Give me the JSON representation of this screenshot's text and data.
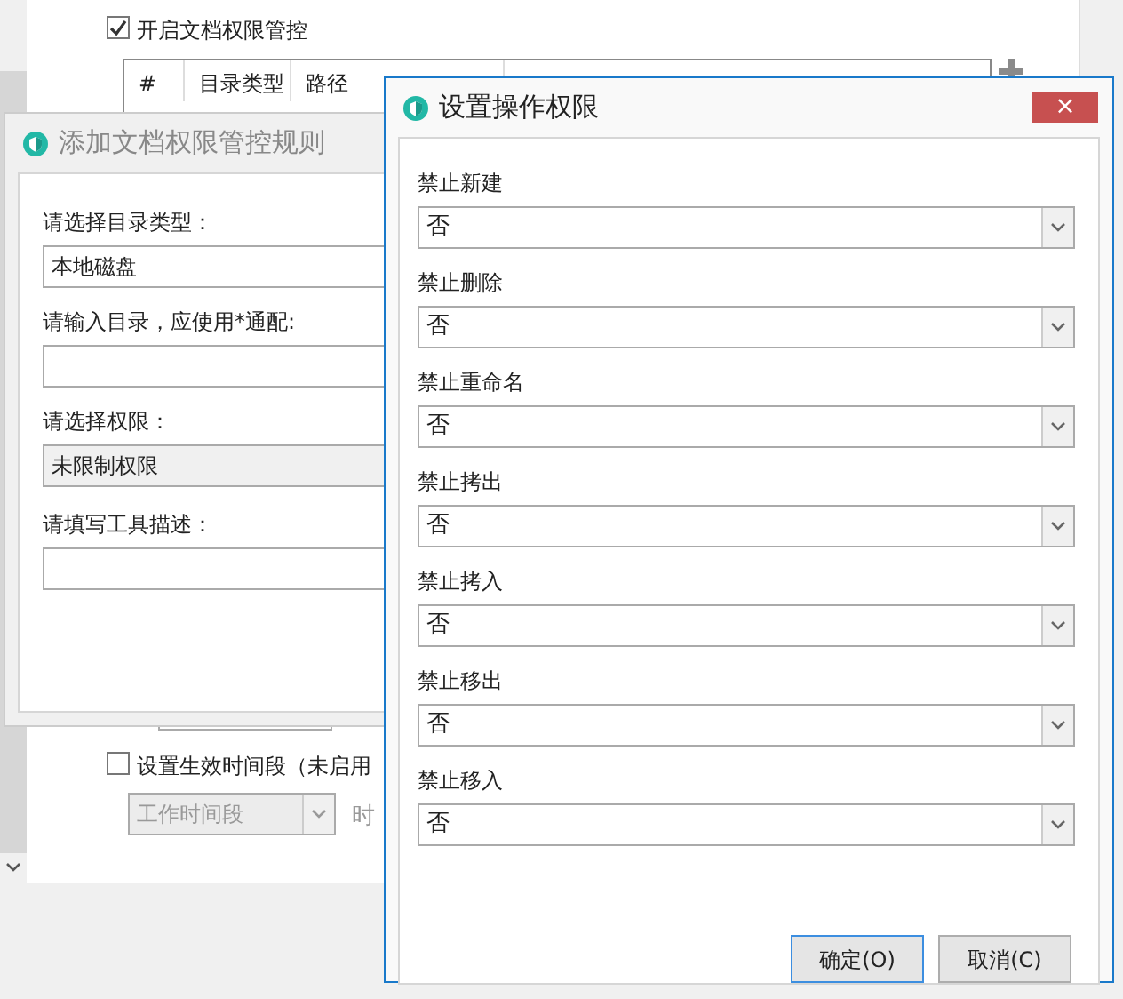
{
  "main": {
    "enable_checkbox": {
      "label": "开启文档权限管控",
      "checked": true
    },
    "table": {
      "columns": [
        "#",
        "目录类型",
        "路径"
      ]
    },
    "period_checkbox": {
      "label": "设置生效时间段（未启用",
      "checked": false
    },
    "period_select": {
      "value": "工作时间段",
      "disabled": true
    },
    "time_label": "时"
  },
  "rule_dialog": {
    "title": "添加文档权限管控规则",
    "active": false,
    "fields": [
      {
        "label": "请选择目录类型：",
        "value": "本地磁盘",
        "disabled": false
      },
      {
        "label": "请输入目录，应使用*通配:",
        "disabled": false
      },
      {
        "label": "请选择权限：",
        "value": "未限制权限",
        "disabled": true
      },
      {
        "label": "请填写工具描述：",
        "disabled": false
      }
    ]
  },
  "permission_dialog": {
    "title": "设置操作权限",
    "active": true,
    "close": "×",
    "settings": [
      {
        "label": "禁止新建",
        "value": "否"
      },
      {
        "label": "禁止删除",
        "value": "否"
      },
      {
        "label": "禁止重命名",
        "value": "否"
      },
      {
        "label": "禁止拷出",
        "value": "否"
      },
      {
        "label": "禁止拷入",
        "value": "否"
      },
      {
        "label": "禁止移出",
        "value": "否"
      },
      {
        "label": "禁止移入",
        "value": "否"
      }
    ],
    "buttons": [
      {
        "label": "确定(O)",
        "primary": true
      },
      {
        "label": "取消(C)",
        "primary": false
      }
    ]
  }
}
